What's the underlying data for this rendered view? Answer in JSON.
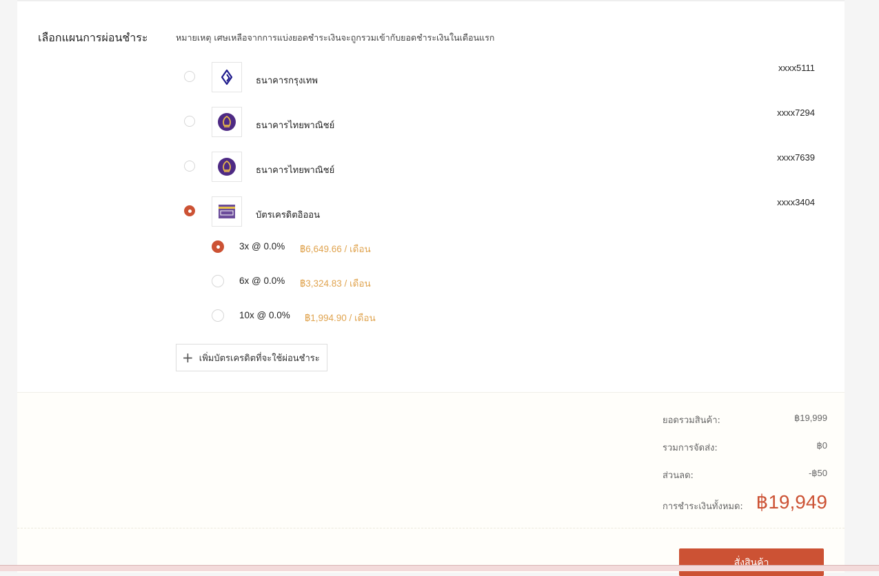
{
  "installment": {
    "title": "เลือกแผนการผ่อนชำระ",
    "note": "หมายเหตุ เศษเหลือจากการแบ่งยอดชำระเงินจะถูกรวมเข้ากับยอดชำระเงินในเดือนแรก",
    "banks": [
      {
        "name": "ธนาคารกรุงเทพ",
        "account": "xxxx5111",
        "logo": "bangkok-bank-logo",
        "selected": false
      },
      {
        "name": "ธนาคารไทยพาณิชย์",
        "account": "xxxx7294",
        "logo": "scb-logo",
        "selected": false
      },
      {
        "name": "ธนาคารไทยพาณิชย์",
        "account": "xxxx7639",
        "logo": "scb-logo",
        "selected": false
      },
      {
        "name": "บัตรเครดิตอิออน",
        "account": "xxxx3404",
        "logo": "aeon-logo",
        "selected": true
      }
    ],
    "plans": [
      {
        "term": "3x @ 0.0%",
        "price": "฿6,649.66 / เดือน",
        "selected": true
      },
      {
        "term": "6x @ 0.0%",
        "price": "฿3,324.83 / เดือน",
        "selected": false
      },
      {
        "term": "10x @ 0.0%",
        "price": "฿1,994.90 / เดือน",
        "selected": false
      }
    ],
    "add_card_label": "เพิ่มบัตรเครดิตที่จะใช้ผ่อนชำระ"
  },
  "summary": {
    "subtotal_label": "ยอดรวมสินค้า:",
    "subtotal_value": "฿19,999",
    "shipping_label": "รวมการจัดส่ง:",
    "shipping_value": "฿0",
    "discount_label": "ส่วนลด:",
    "discount_value": "-฿50",
    "total_label": "การชำระเงินทั้งหมด:",
    "total_value": "฿19,949",
    "order_button": "สั่งสินค้า"
  },
  "colors": {
    "accent": "#cc5234",
    "price": "#e0a450",
    "scb_purple": "#4e2a84",
    "bbl_navy": "#1e1a8c",
    "aeon_purple": "#6b4c9a"
  }
}
